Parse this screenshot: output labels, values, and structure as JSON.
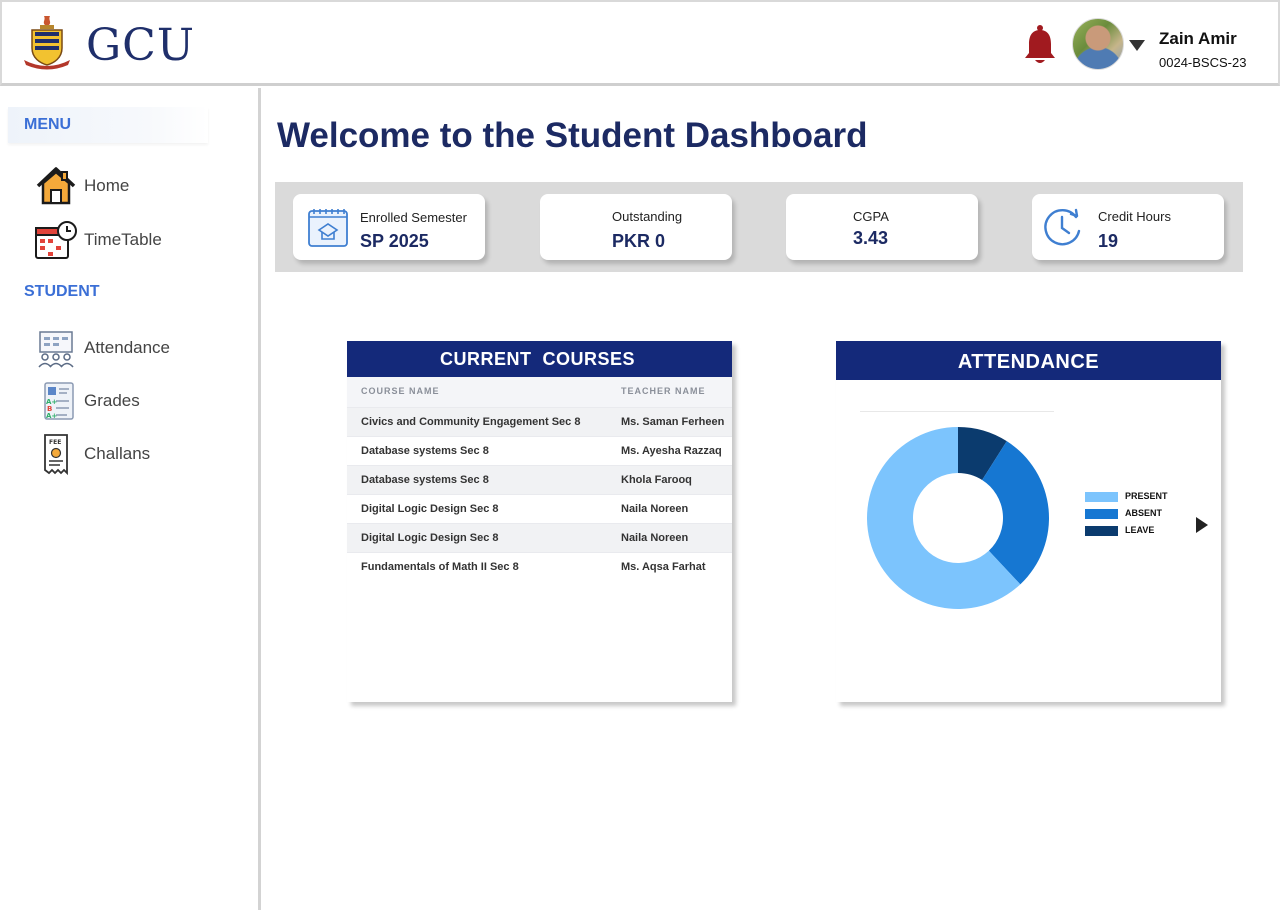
{
  "header": {
    "logo_text": "GCU",
    "user": {
      "name": "Zain Amir",
      "id": "0024-BSCS-23"
    },
    "icons": {
      "notifications": "bell-icon",
      "menu": "chevron-down-icon"
    },
    "colors": {
      "bell": "#a11a1f",
      "brand": "#1f2f6b"
    }
  },
  "sidebar": {
    "menu_heading": "MENU",
    "menu_items": [
      {
        "label": "Home",
        "icon": "home-icon"
      },
      {
        "label": "TimeTable",
        "icon": "timetable-icon"
      }
    ],
    "student_heading": "STUDENT",
    "student_items": [
      {
        "label": "Attendance",
        "icon": "attendance-icon"
      },
      {
        "label": "Grades",
        "icon": "grades-icon"
      },
      {
        "label": "Challans",
        "icon": "challan-icon"
      }
    ],
    "colors": {
      "heading": "#3b6fd6"
    }
  },
  "main": {
    "title": "Welcome to the Student Dashboard",
    "stats": [
      {
        "label": "Enrolled Semester",
        "value": "SP 2025",
        "icon": "semester-calendar-icon"
      },
      {
        "label": "Outstanding",
        "value": "PKR 0"
      },
      {
        "label": "CGPA",
        "value": "3.43"
      },
      {
        "label": "Credit Hours",
        "value": "19",
        "icon": "clock-icon"
      }
    ],
    "courses": {
      "title": "CURRENT  COURSES",
      "col_course": "COURSE NAME",
      "col_teacher": "TEACHER NAME",
      "rows": [
        {
          "course": "Civics and Community Engagement Sec 8",
          "teacher": "Ms. Saman Ferheen"
        },
        {
          "course": "Database systems Sec 8",
          "teacher": "Ms. Ayesha Razzaq"
        },
        {
          "course": "Database systems Sec 8",
          "teacher": "Khola Farooq"
        },
        {
          "course": "Digital Logic Design Sec 8",
          "teacher": "Naila Noreen"
        },
        {
          "course": "Digital Logic Design Sec 8",
          "teacher": "Naila Noreen"
        },
        {
          "course": "Fundamentals of Math II Sec 8",
          "teacher": "Ms. Aqsa Farhat"
        }
      ]
    },
    "attendance": {
      "title": "ATTENDANCE",
      "chart_data": {
        "type": "pie",
        "categories": [
          "PRESENT",
          "ABSENT",
          "LEAVE"
        ],
        "values": [
          62,
          29,
          9
        ],
        "colors": [
          "#7cc4fd",
          "#1677d2",
          "#0b3b6e"
        ]
      }
    },
    "colors": {
      "panel_header": "#14297a",
      "title": "#1c2a63"
    }
  }
}
